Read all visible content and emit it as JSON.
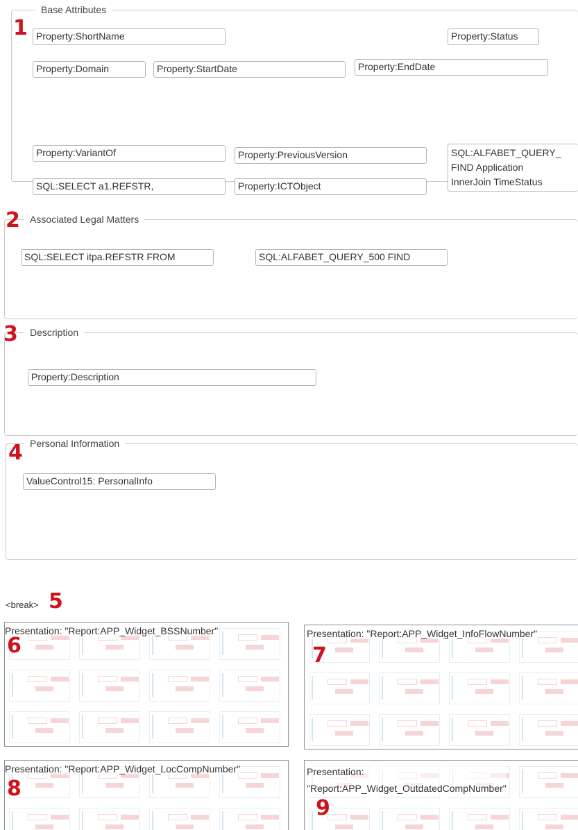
{
  "sections": {
    "base": {
      "legend": "Base Attributes",
      "number": "1",
      "fields": {
        "short_name": "Property:ShortName",
        "status": "Property:Status",
        "domain": "Property:Domain",
        "start_date": "Property:StartDate",
        "end_date": "Property:EndDate",
        "variant_of": "Property:VariantOf",
        "previous_version": "Property:PreviousVersion",
        "sql_query_line1": "SQL:ALFABET_QUERY_",
        "sql_query_line2": "FIND Application",
        "sql_query_line3": "InnerJoin TimeStatus",
        "sql_select": "SQL:SELECT a1.REFSTR,",
        "ict_object": "Property:ICTObject"
      }
    },
    "legal": {
      "legend": "Associated Legal Matters",
      "number": "2",
      "fields": {
        "sql_select": "SQL:SELECT itpa.REFSTR FROM",
        "sql_query": "SQL:ALFABET_QUERY_500 FIND"
      }
    },
    "description": {
      "legend": "Description",
      "number": "3",
      "fields": {
        "description": "Property:Description"
      }
    },
    "personal": {
      "legend": "Personal Information",
      "number": "4",
      "fields": {
        "personal_info": "ValueControl15: PersonalInfo"
      }
    }
  },
  "break": {
    "text": "<break>",
    "number": "5"
  },
  "widgets": [
    {
      "title": "Presentation: \"Report:APP_Widget_BSSNumber\"",
      "number": "6"
    },
    {
      "title": "Presentation: \"Report:APP_Widget_InfoFlowNumber\"",
      "number": "7"
    },
    {
      "title": "Presentation: \"Report:APP_Widget_LocCompNumber\"",
      "number": "8"
    },
    {
      "title_line1": "Presentation:",
      "title_line2": "\"Report:APP_Widget_OutdatedCompNumber\"",
      "number": "9"
    }
  ]
}
